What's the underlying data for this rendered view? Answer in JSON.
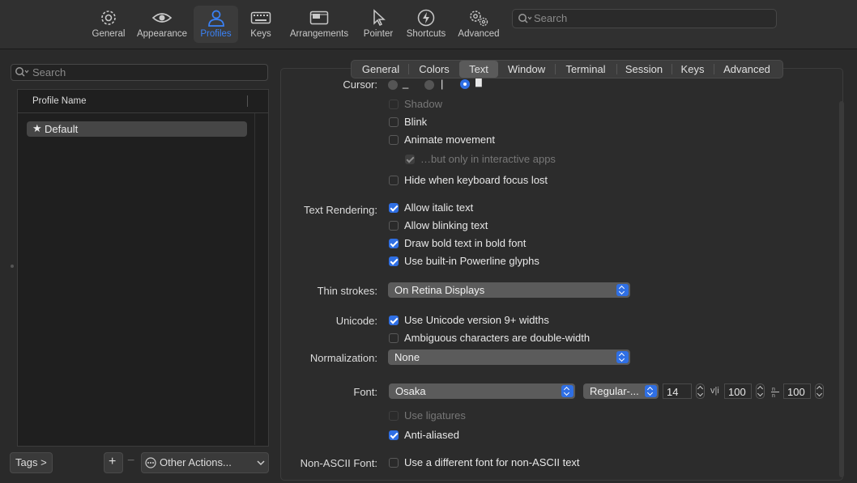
{
  "toolbar": {
    "items": [
      {
        "label": "General",
        "icon": "gear-icon"
      },
      {
        "label": "Appearance",
        "icon": "eye-icon"
      },
      {
        "label": "Profiles",
        "icon": "person-icon"
      },
      {
        "label": "Keys",
        "icon": "keyboard-icon"
      },
      {
        "label": "Arrangements",
        "icon": "windows-icon"
      },
      {
        "label": "Pointer",
        "icon": "pointer-icon"
      },
      {
        "label": "Shortcuts",
        "icon": "bolt-icon"
      },
      {
        "label": "Advanced",
        "icon": "gears-icon"
      }
    ],
    "selected": "Profiles",
    "search_placeholder": "Search"
  },
  "left": {
    "search_placeholder": "Search",
    "column_header": "Profile Name",
    "profiles": [
      {
        "name": "Default",
        "starred": true
      }
    ],
    "tags_button": "Tags >",
    "add_button": "+",
    "remove_button": "−",
    "other_actions": "Other Actions..."
  },
  "tabs": {
    "items": [
      "General",
      "Colors",
      "Text",
      "Window",
      "Terminal",
      "Session",
      "Keys",
      "Advanced"
    ],
    "selected": "Text"
  },
  "text": {
    "cursor_label": "Cursor:",
    "cursor_options": [
      "_",
      "|",
      "█"
    ],
    "cursor_selected": "█",
    "shadow": "Shadow",
    "blink": "Blink",
    "animate": "Animate movement",
    "animate_interactive": "…but only in interactive apps",
    "hide_focus": "Hide when keyboard focus lost",
    "rendering_label": "Text Rendering:",
    "allow_italic": "Allow italic text",
    "allow_blinking": "Allow blinking text",
    "draw_bold": "Draw bold text in bold font",
    "powerline": "Use built-in Powerline glyphs",
    "thin_label": "Thin strokes:",
    "thin_value": "On Retina Displays",
    "unicode_label": "Unicode:",
    "unicode9": "Use Unicode version 9+ widths",
    "ambiguous": "Ambiguous characters are double-width",
    "normalization_label": "Normalization:",
    "normalization_value": "None",
    "font_label": "Font:",
    "font_family": "Osaka",
    "font_style": "Regular-...",
    "font_size": "14",
    "vspacing_icon": "v|i",
    "vspacing": "100",
    "hspacing_icon": "n/n",
    "hspacing": "100",
    "ligatures": "Use ligatures",
    "antialiased": "Anti-aliased",
    "nonascii_label": "Non-ASCII Font:",
    "nonascii": "Use a different font for non-ASCII text"
  },
  "colors": {
    "accent": "#2f6fe4",
    "selected_toolbar": "#3a82f7"
  }
}
